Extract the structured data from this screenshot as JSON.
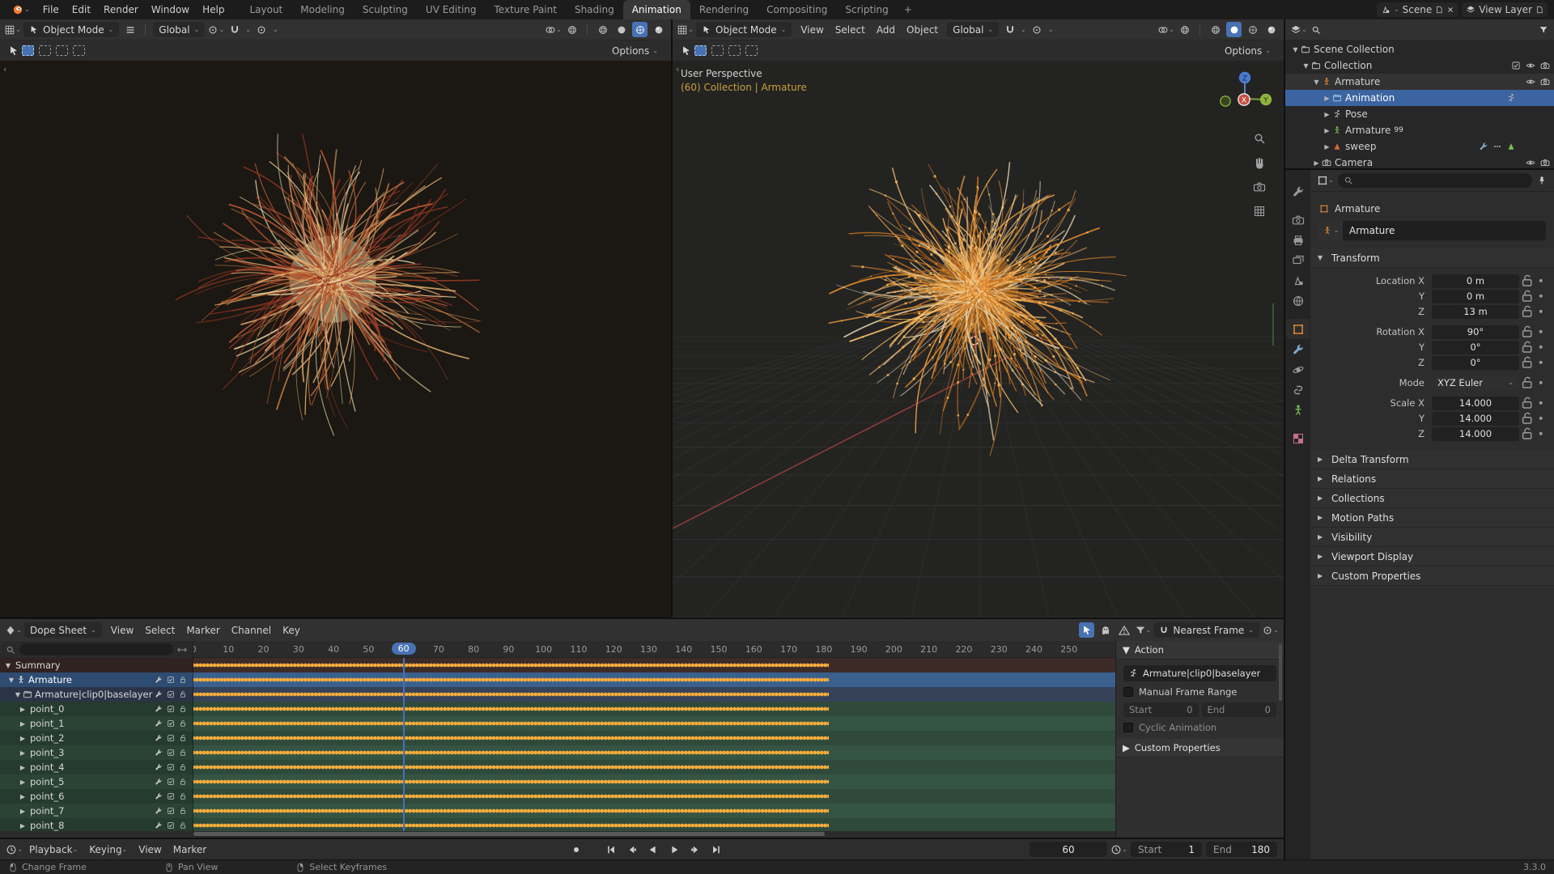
{
  "topbar": {
    "menus": [
      "File",
      "Edit",
      "Render",
      "Window",
      "Help"
    ],
    "workspaces": [
      "Layout",
      "Modeling",
      "Sculpting",
      "UV Editing",
      "Texture Paint",
      "Shading",
      "Animation",
      "Rendering",
      "Compositing",
      "Scripting"
    ],
    "active_workspace": "Animation",
    "new_workspace": "+",
    "scene_label": "Scene",
    "view_layer_label": "View Layer"
  },
  "viewport_left": {
    "mode": "Object Mode",
    "orientation": "Global",
    "options_label": "Options"
  },
  "viewport_right": {
    "mode": "Object Mode",
    "menus": [
      "View",
      "Select",
      "Add",
      "Object"
    ],
    "orientation": "Global",
    "options_label": "Options",
    "view_label": "User Perspective",
    "context_label": "(60) Collection | Armature",
    "gizmo_axes": {
      "x": "X",
      "y": "Y",
      "z": "Z"
    }
  },
  "outliner": {
    "rows": [
      {
        "label": "Scene Collection",
        "depth": 0,
        "icon": "collection",
        "arrow": "down"
      },
      {
        "label": "Collection",
        "depth": 1,
        "icon": "collection",
        "arrow": "down",
        "right": [
          "check",
          "eye",
          "camera"
        ]
      },
      {
        "label": "Armature",
        "depth": 2,
        "icon": "stickman-orange",
        "arrow": "down",
        "active": true,
        "right": [
          "eye",
          "camera"
        ]
      },
      {
        "label": "Animation",
        "depth": 3,
        "icon": "clapper",
        "arrow": "right",
        "selected": true,
        "mid": [
          "runner"
        ]
      },
      {
        "label": "Pose",
        "depth": 3,
        "icon": "runner",
        "arrow": "right"
      },
      {
        "label": "Armature",
        "depth": 3,
        "icon": "stickman-green",
        "arrow": "right",
        "badge": "99"
      },
      {
        "label": "sweep",
        "depth": 3,
        "icon": "cone-orange",
        "arrow": "right",
        "mid": [
          "wrench",
          "dots3",
          "cone-green"
        ]
      },
      {
        "label": "Camera",
        "depth": 2,
        "icon": "camera",
        "arrow": "right",
        "right": [
          "eye",
          "camera"
        ]
      }
    ]
  },
  "properties": {
    "search_placeholder": "",
    "tabs": [
      "tool",
      "render",
      "output",
      "view-layer",
      "scene",
      "world",
      "object",
      "modifiers",
      "physics",
      "constraints",
      "object-data",
      "texture"
    ],
    "active_tab": "object",
    "breadcrumb_object": "Armature",
    "name_value": "Armature",
    "transform_title": "Transform",
    "fields": [
      {
        "label": "Location X",
        "value": "0 m"
      },
      {
        "label": "Y",
        "value": "0 m"
      },
      {
        "label": "Z",
        "value": "13 m"
      },
      {
        "label": "Rotation X",
        "value": "90°",
        "gap": true
      },
      {
        "label": "Y",
        "value": "0°"
      },
      {
        "label": "Z",
        "value": "0°"
      },
      {
        "label": "Mode",
        "value": "XYZ Euler",
        "dropdown": true,
        "gap": true
      },
      {
        "label": "Scale X",
        "value": "14.000",
        "gap": true
      },
      {
        "label": "Y",
        "value": "14.000"
      },
      {
        "label": "Z",
        "value": "14.000"
      }
    ],
    "collapsed_panels": [
      "Delta Transform",
      "Relations",
      "Collections",
      "Motion Paths",
      "Visibility",
      "Viewport Display",
      "Custom Properties"
    ]
  },
  "dopesheet": {
    "editor_type": "Dope Sheet",
    "menus": [
      "View",
      "Select",
      "Marker",
      "Channel",
      "Key"
    ],
    "snap_mode": "Nearest Frame",
    "ruler_labels": [
      "0",
      "10",
      "20",
      "30",
      "40",
      "50",
      "60",
      "70",
      "80",
      "90",
      "100",
      "110",
      "120",
      "130",
      "140",
      "150",
      "160",
      "170",
      "180",
      "190",
      "200",
      "210",
      "220",
      "230",
      "240",
      "250"
    ],
    "current_frame": "60",
    "key_range": [
      0,
      180
    ],
    "channels": [
      {
        "name": "Summary",
        "type": "summary"
      },
      {
        "name": "Armature",
        "type": "object",
        "selected": true
      },
      {
        "name": "Armature|clip0|baselayer",
        "type": "action"
      },
      {
        "name": "point_0",
        "type": "bone"
      },
      {
        "name": "point_1",
        "type": "bone"
      },
      {
        "name": "point_2",
        "type": "bone"
      },
      {
        "name": "point_3",
        "type": "bone"
      },
      {
        "name": "point_4",
        "type": "bone"
      },
      {
        "name": "point_5",
        "type": "bone"
      },
      {
        "name": "point_6",
        "type": "bone"
      },
      {
        "name": "point_7",
        "type": "bone"
      },
      {
        "name": "point_8",
        "type": "bone"
      }
    ],
    "sidebar": {
      "panel_title": "Action",
      "action_name": "Armature|clip0|baselayer",
      "manual_range_label": "Manual Frame Range",
      "start_label": "Start",
      "start_value": "0",
      "end_label": "End",
      "end_value": "0",
      "cyclic_label": "Cyclic Animation",
      "custom_props_label": "Custom Properties"
    }
  },
  "playback": {
    "menus": [
      "Playback",
      "Keying",
      "View",
      "Marker"
    ],
    "frame_value": "60",
    "start_label": "Start",
    "start_value": "1",
    "end_label": "End",
    "end_value": "180"
  },
  "statusbar": {
    "hints": [
      {
        "icon": "mouse-left",
        "label": "Change Frame"
      },
      {
        "icon": "mouse-middle",
        "label": "Pan View"
      },
      {
        "icon": "mouse-right",
        "label": "Select Keyframes"
      }
    ],
    "version": "3.3.0"
  },
  "colors": {
    "accent": "#4772b3",
    "keyframe": "#f6ad3c",
    "summary_row": "#3c2b28",
    "object_row": "#3a608e",
    "action_row": "#354258",
    "bone_row_a": "#2f4a3b",
    "bone_row_b": "#355443",
    "plant_left": [
      "#e2d3a0",
      "#d8a96a",
      "#c97f45",
      "#bf5a31",
      "#a93f26",
      "#8e3220"
    ],
    "plant_right": [
      "#f2a342",
      "#e08a28",
      "#d0761d",
      "#f6bd6b",
      "#b5641c",
      "#e8d5b0"
    ]
  }
}
